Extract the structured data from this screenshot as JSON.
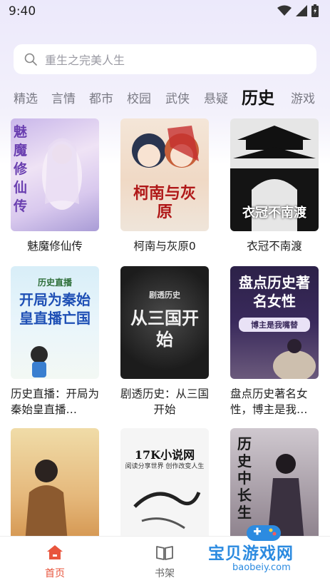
{
  "status": {
    "time": "9:40"
  },
  "search": {
    "placeholder": "重生之完美人生"
  },
  "tabs": [
    "精选",
    "言情",
    "都市",
    "校园",
    "武侠",
    "悬疑",
    "历史",
    "游戏"
  ],
  "active_tab": "历史",
  "books": [
    {
      "title": "魅魔修仙传",
      "cover_text": "魅魔修仙传"
    },
    {
      "title": "柯南与灰原0",
      "cover_text": "柯南与灰原"
    },
    {
      "title": "衣冠不南渡",
      "cover_text": "衣冠不南渡"
    },
    {
      "title": "历史直播：开局为秦始皇直播…",
      "cover_text": "开局为秦始皇直播亡国"
    },
    {
      "title": "剧透历史：从三国开始",
      "cover_text": "从三国开始"
    },
    {
      "title": "盘点历史著名女性，博主是我…",
      "cover_text": "盘点历史著名女性"
    },
    {
      "title": "",
      "cover_text": ""
    },
    {
      "title": "",
      "cover_text": "17K小说网"
    },
    {
      "title": "",
      "cover_text": "历史中长生"
    }
  ],
  "cover_small": {
    "b4_top": "历史直播",
    "b5_top": "剧透历史",
    "b6_sub": "博主是我嘴替",
    "b8_sub": "阅读分享世界 创作改变人生"
  },
  "bottom_nav": [
    {
      "label": "首页",
      "icon": "home-icon",
      "active": true
    },
    {
      "label": "书架",
      "icon": "bookshelf-icon",
      "active": false
    }
  ],
  "watermark": {
    "text": "宝贝游戏网",
    "url": "baobeiy.com"
  },
  "colors": {
    "accent": "#e8553d",
    "inactive": "#666666",
    "watermark": "#2c8be0"
  }
}
